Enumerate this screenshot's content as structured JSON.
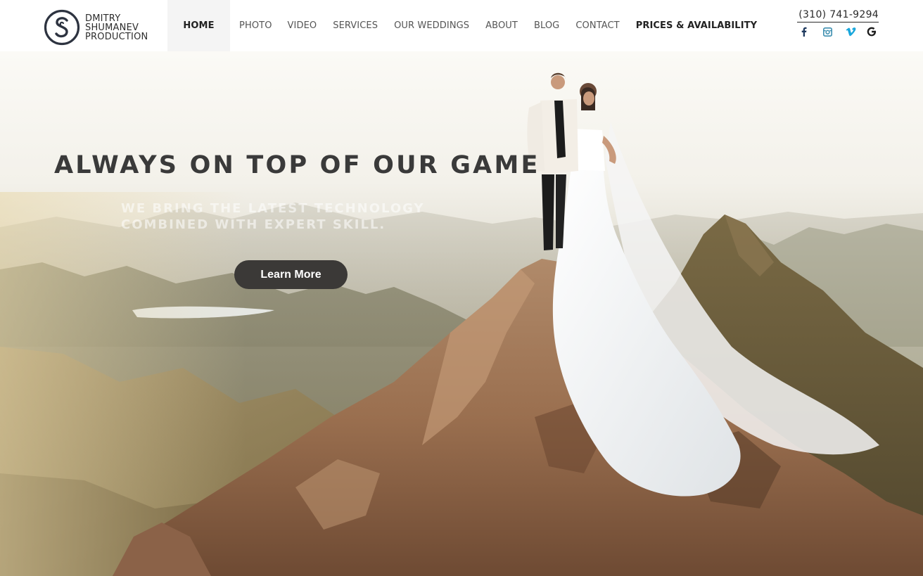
{
  "brand": {
    "lines": [
      "DMITRY",
      "SHUMANEV",
      "PRODUCTION"
    ]
  },
  "nav": {
    "items": [
      {
        "label": "HOME"
      },
      {
        "label": "PHOTO"
      },
      {
        "label": "VIDEO"
      },
      {
        "label": "SERVICES"
      },
      {
        "label": "OUR WEDDINGS"
      },
      {
        "label": "ABOUT"
      },
      {
        "label": "BLOG"
      },
      {
        "label": "CONTACT"
      },
      {
        "label": "PRICES & AVAILABILITY"
      }
    ],
    "active": "HOME"
  },
  "contact": {
    "phone": "(310) 741-9294",
    "socials": [
      "facebook-icon",
      "instagram-icon",
      "vimeo-icon",
      "google-icon"
    ]
  },
  "hero": {
    "title": "ALWAYS ON TOP OF OUR GAME",
    "subtitle": "WE BRING THE LATEST TECHNOLOGY COMBINED WITH EXPERT SKILL.",
    "button_label": "Learn More"
  },
  "colors": {
    "button_bg": "#3b3937",
    "title": "#3a3a3a",
    "nav_active_bg": "#f4f4f4"
  }
}
